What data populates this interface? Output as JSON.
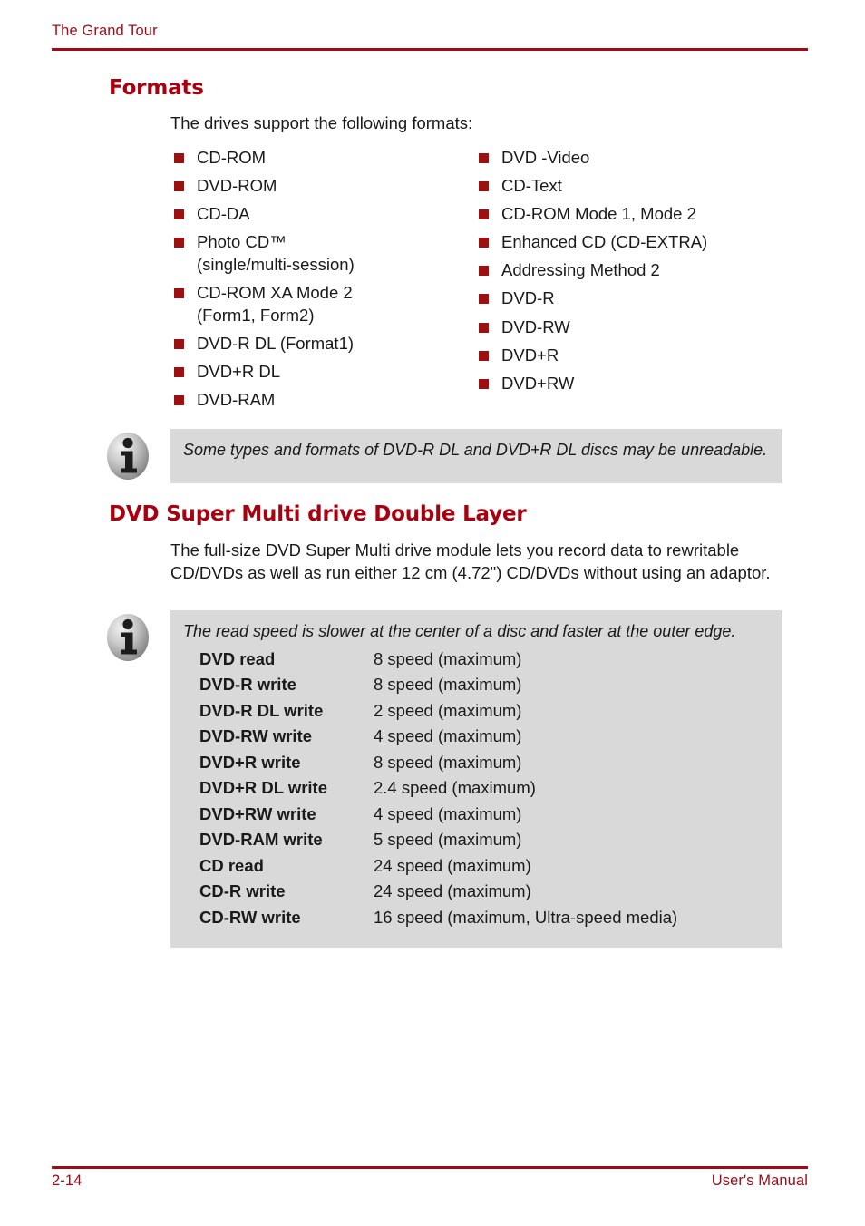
{
  "header": {
    "chapter_title": "The Grand Tour",
    "rule_color": "#9E0B16"
  },
  "sections": {
    "formats": {
      "heading": "Formats",
      "intro": "The drives support the following formats:",
      "bullet_color": "#9E1010",
      "left_column": [
        "CD-ROM",
        "DVD-ROM",
        "CD-DA",
        "Photo CD™\n(single/multi-session)",
        "CD-ROM XA Mode 2\n(Form1, Form2)",
        "DVD-R DL (Format1)",
        "DVD+R DL",
        "DVD-RAM"
      ],
      "right_column": [
        "DVD -Video",
        "CD-Text",
        "CD-ROM Mode 1, Mode 2",
        "Enhanced CD (CD-EXTRA)",
        "Addressing Method 2",
        "DVD-R",
        "DVD-RW",
        "DVD+R",
        "DVD+RW"
      ]
    },
    "dvd_super_multi": {
      "heading": "DVD Super Multi drive Double Layer",
      "paragraph": "The full-size DVD Super Multi drive module lets you record data to rewritable CD/DVDs as well as run either 12 cm (4.72\") CD/DVDs without using an adaptor."
    }
  },
  "notes": {
    "note_1": {
      "icon": "info-icon",
      "text": "Some types and formats of DVD-R DL and DVD+R DL discs may be unreadable.",
      "background": "#D9D9D9"
    },
    "note_2": {
      "icon": "info-icon",
      "text": "The read speed is slower at the center of a disc and faster at the outer edge.",
      "background": "#D9D9D9",
      "spec_rows": [
        {
          "name": "DVD read",
          "value": "8 speed (maximum)"
        },
        {
          "name": "DVD-R write",
          "value": "8 speed (maximum)"
        },
        {
          "name": "DVD-R DL write",
          "value": "2 speed (maximum)"
        },
        {
          "name": "DVD-RW write",
          "value": "4 speed (maximum)"
        },
        {
          "name": "DVD+R write",
          "value": "8 speed (maximum)"
        },
        {
          "name": "DVD+R DL write",
          "value": "2.4 speed (maximum)"
        },
        {
          "name": "DVD+RW write",
          "value": "4 speed (maximum)"
        },
        {
          "name": "DVD-RAM write",
          "value": "5 speed (maximum)"
        },
        {
          "name": "CD read",
          "value": "24 speed (maximum)"
        },
        {
          "name": "CD-R write",
          "value": "24 speed (maximum)"
        },
        {
          "name": "CD-RW write",
          "value": "16 speed (maximum, Ultra-speed media)"
        }
      ]
    }
  },
  "footer": {
    "page_number": "2-14",
    "manual_label": "User's Manual"
  }
}
